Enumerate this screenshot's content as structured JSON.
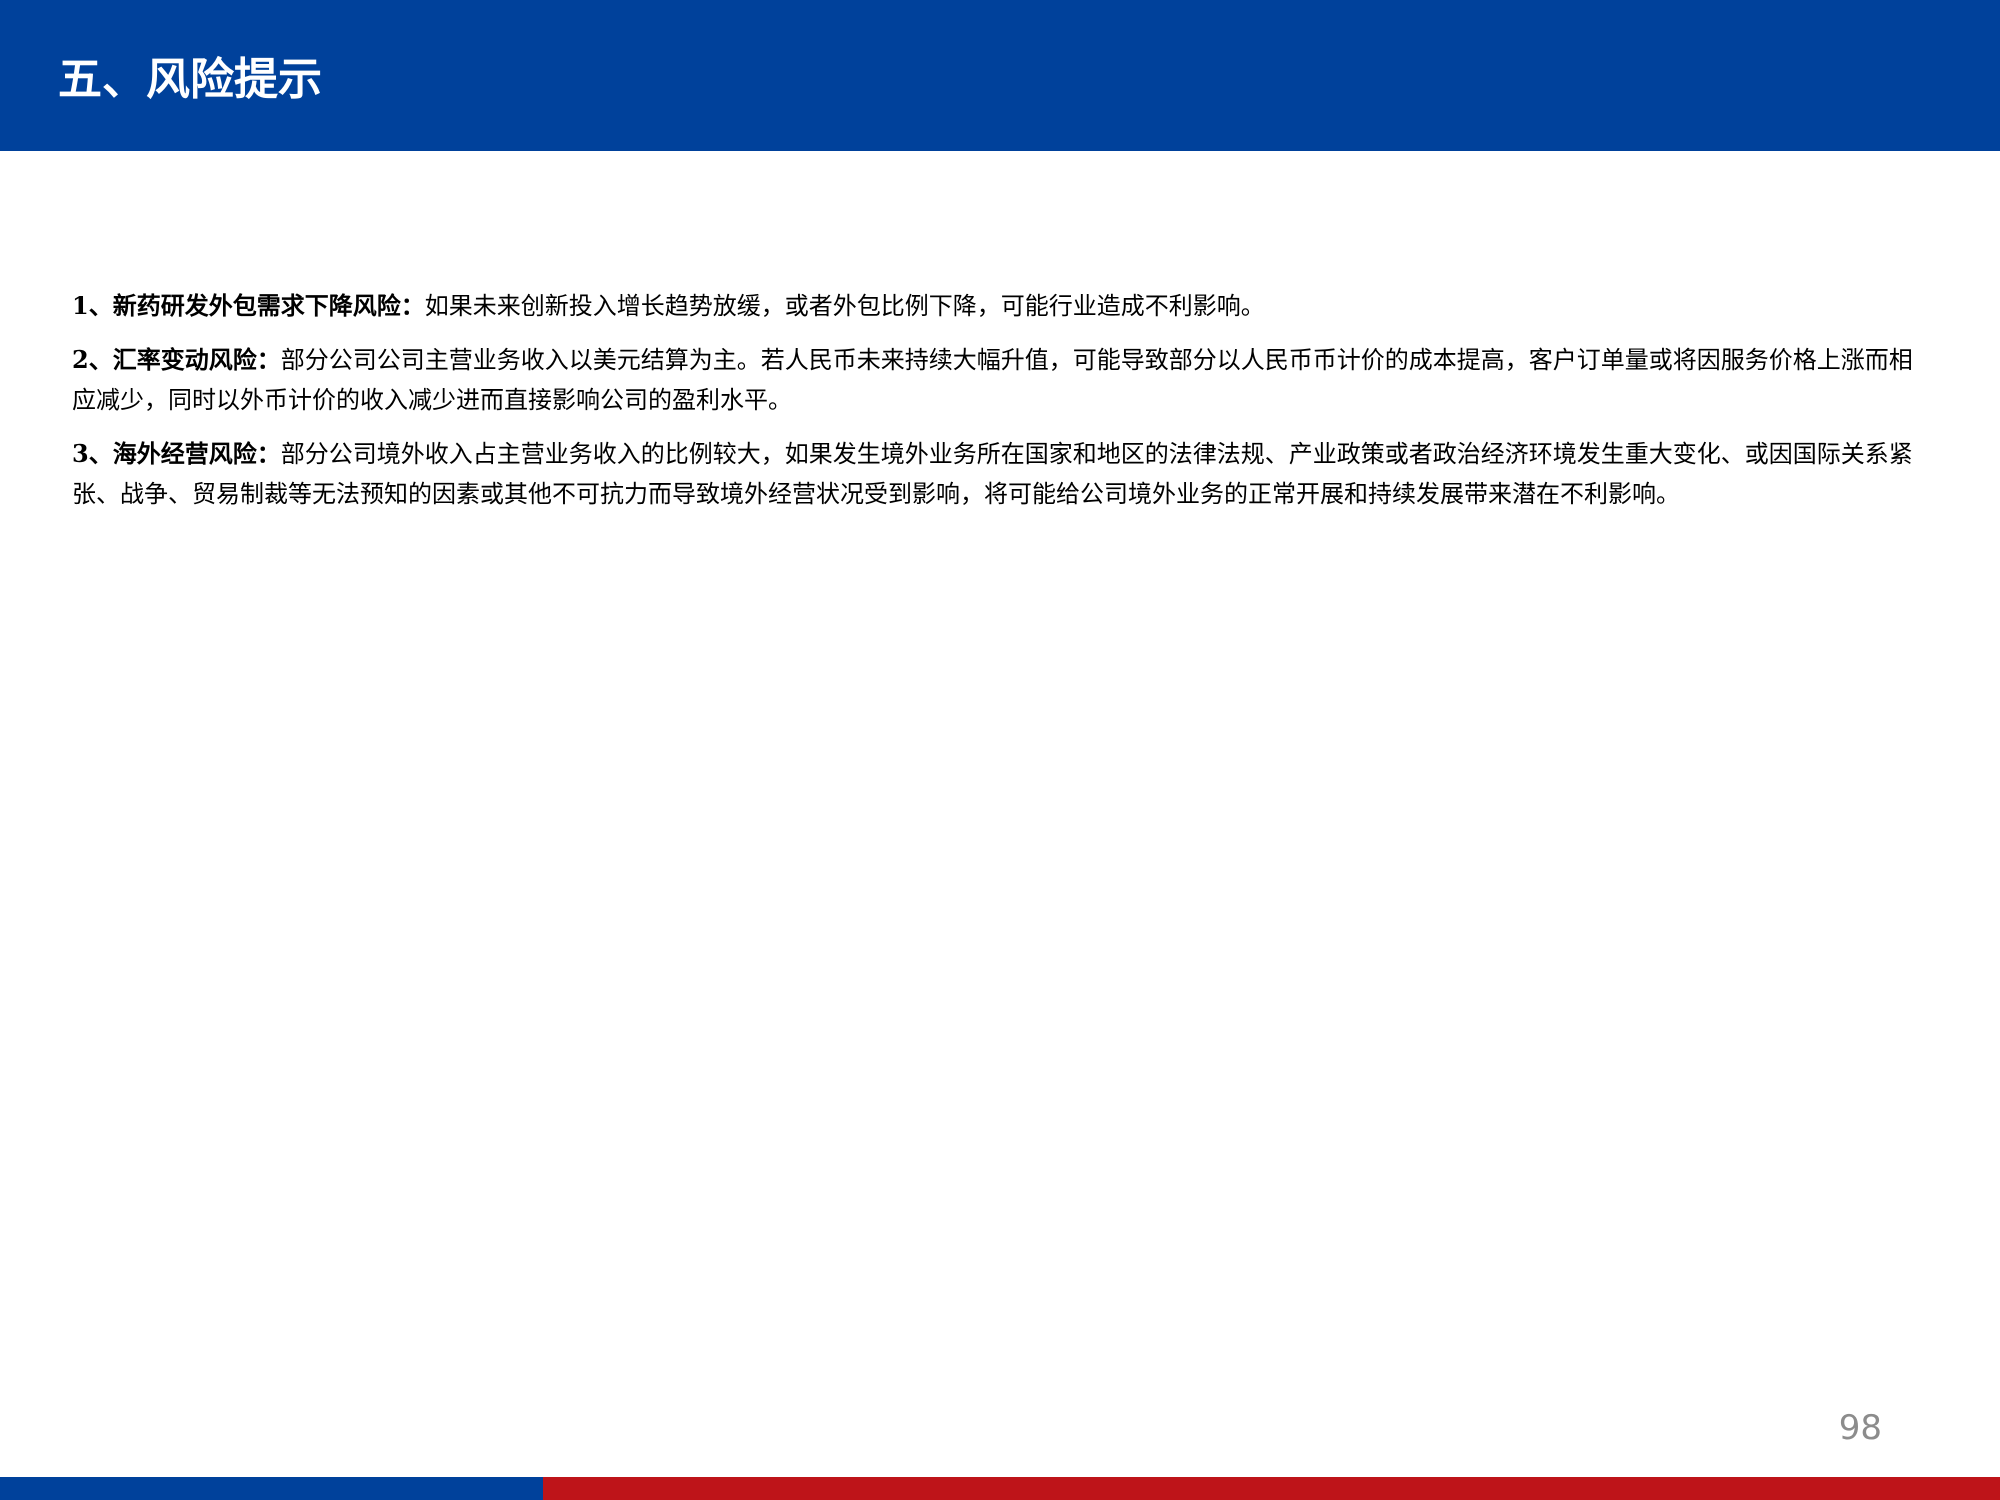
{
  "header": {
    "title": "五、风险提示"
  },
  "risks": [
    {
      "heading": "1、新药研发外包需求下降风险：",
      "text": "如果未来创新投入增长趋势放缓，或者外包比例下降，可能行业造成不利影响。"
    },
    {
      "heading": "2、汇率变动风险：",
      "text": "部分公司公司主营业务收入以美元结算为主。若人民币未来持续大幅升值，可能导致部分以人民币币计价的成本提高，客户订单量或将因服务价格上涨而相应减少，同时以外币计价的收入减少进而直接影响公司的盈利水平。"
    },
    {
      "heading": "3、海外经营风险：",
      "text": "部分公司境外收入占主营业务收入的比例较大，如果发生境外业务所在国家和地区的法律法规、产业政策或者政治经济环境发生重大变化、或因国际关系紧张、战争、贸易制裁等无法预知的因素或其他不可抗力而导致境外经营状况受到影响，将可能给公司境外业务的正常开展和持续发展带来潜在不利影响。"
    }
  ],
  "footer": {
    "page_number": "98",
    "left_bar_color": "#00419B",
    "right_bar_color": "#BE1419"
  }
}
